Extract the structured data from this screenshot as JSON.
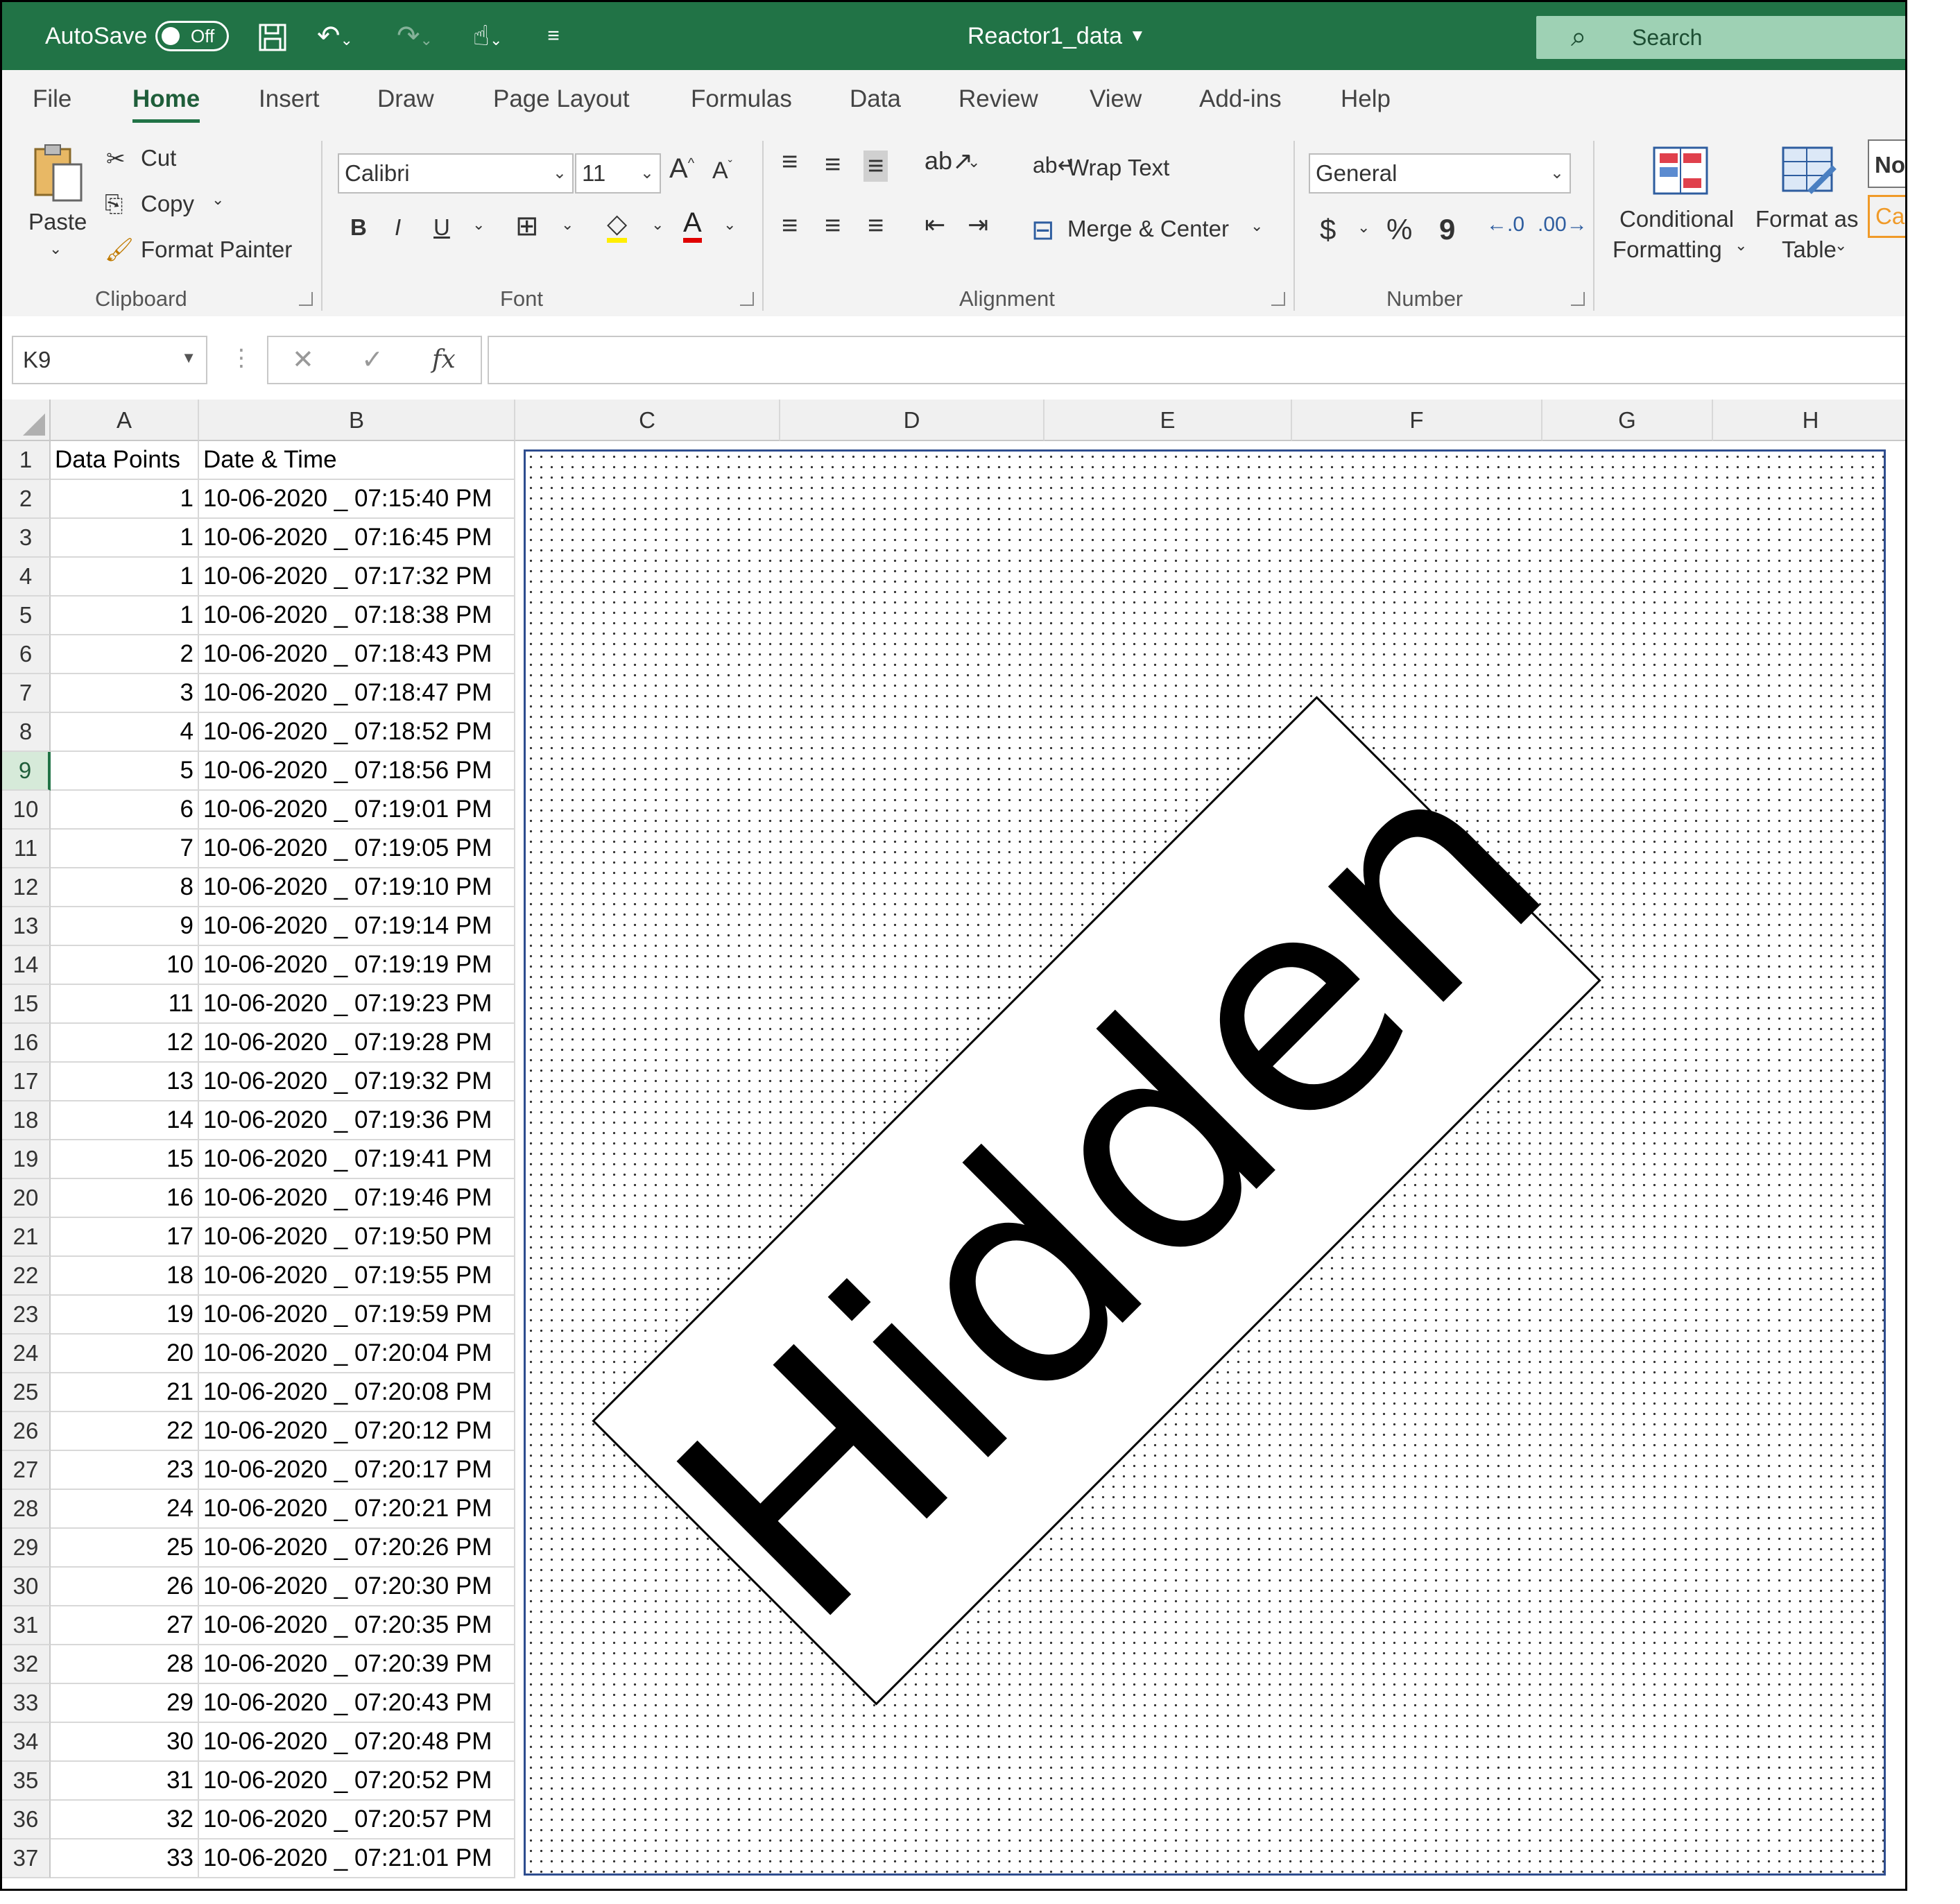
{
  "titlebar": {
    "autosave_label": "AutoSave",
    "autosave_state": "Off",
    "file_name": "Reactor1_data",
    "search_placeholder": "Search"
  },
  "tabs": [
    "File",
    "Home",
    "Insert",
    "Draw",
    "Page Layout",
    "Formulas",
    "Data",
    "Review",
    "View",
    "Add-ins",
    "Help"
  ],
  "ribbon": {
    "clipboard": {
      "paste": "Paste",
      "cut": "Cut",
      "copy": "Copy",
      "format_painter": "Format Painter",
      "group": "Clipboard"
    },
    "font": {
      "name": "Calibri",
      "size": "11",
      "bold": "B",
      "italic": "I",
      "underline": "U",
      "group": "Font"
    },
    "alignment": {
      "wrap": "Wrap Text",
      "merge": "Merge & Center",
      "group": "Alignment"
    },
    "number": {
      "format": "General",
      "currency": "$",
      "percent": "%",
      "comma": "9",
      "group": "Number"
    },
    "styles": {
      "conditional_1": "Conditional",
      "conditional_2": "Formatting",
      "table_1": "Format as",
      "table_2": "Table",
      "style_normal": "No",
      "style_calc": "Ca"
    }
  },
  "formula_bar": {
    "name_box": "K9",
    "fx": "fx",
    "value": ""
  },
  "columns": [
    "A",
    "B",
    "C",
    "D",
    "E",
    "F",
    "G",
    "H"
  ],
  "sheet": {
    "header": {
      "a": "Data Points",
      "b": "Date & Time"
    },
    "rows": [
      {
        "a": "1",
        "b": "10-06-2020 _ 07:15:40 PM"
      },
      {
        "a": "1",
        "b": "10-06-2020 _ 07:16:45 PM"
      },
      {
        "a": "1",
        "b": "10-06-2020 _ 07:17:32 PM"
      },
      {
        "a": "1",
        "b": "10-06-2020 _ 07:18:38 PM"
      },
      {
        "a": "2",
        "b": "10-06-2020 _ 07:18:43 PM"
      },
      {
        "a": "3",
        "b": "10-06-2020 _ 07:18:47 PM"
      },
      {
        "a": "4",
        "b": "10-06-2020 _ 07:18:52 PM"
      },
      {
        "a": "5",
        "b": "10-06-2020 _ 07:18:56 PM"
      },
      {
        "a": "6",
        "b": "10-06-2020 _ 07:19:01 PM"
      },
      {
        "a": "7",
        "b": "10-06-2020 _ 07:19:05 PM"
      },
      {
        "a": "8",
        "b": "10-06-2020 _ 07:19:10 PM"
      },
      {
        "a": "9",
        "b": "10-06-2020 _ 07:19:14 PM"
      },
      {
        "a": "10",
        "b": "10-06-2020 _ 07:19:19 PM"
      },
      {
        "a": "11",
        "b": "10-06-2020 _ 07:19:23 PM"
      },
      {
        "a": "12",
        "b": "10-06-2020 _ 07:19:28 PM"
      },
      {
        "a": "13",
        "b": "10-06-2020 _ 07:19:32 PM"
      },
      {
        "a": "14",
        "b": "10-06-2020 _ 07:19:36 PM"
      },
      {
        "a": "15",
        "b": "10-06-2020 _ 07:19:41 PM"
      },
      {
        "a": "16",
        "b": "10-06-2020 _ 07:19:46 PM"
      },
      {
        "a": "17",
        "b": "10-06-2020 _ 07:19:50 PM"
      },
      {
        "a": "18",
        "b": "10-06-2020 _ 07:19:55 PM"
      },
      {
        "a": "19",
        "b": "10-06-2020 _ 07:19:59 PM"
      },
      {
        "a": "20",
        "b": "10-06-2020 _ 07:20:04 PM"
      },
      {
        "a": "21",
        "b": "10-06-2020 _ 07:20:08 PM"
      },
      {
        "a": "22",
        "b": "10-06-2020 _ 07:20:12 PM"
      },
      {
        "a": "23",
        "b": "10-06-2020 _ 07:20:17 PM"
      },
      {
        "a": "24",
        "b": "10-06-2020 _ 07:20:21 PM"
      },
      {
        "a": "25",
        "b": "10-06-2020 _ 07:20:26 PM"
      },
      {
        "a": "26",
        "b": "10-06-2020 _ 07:20:30 PM"
      },
      {
        "a": "27",
        "b": "10-06-2020 _ 07:20:35 PM"
      },
      {
        "a": "28",
        "b": "10-06-2020 _ 07:20:39 PM"
      },
      {
        "a": "29",
        "b": "10-06-2020 _ 07:20:43 PM"
      },
      {
        "a": "30",
        "b": "10-06-2020 _ 07:20:48 PM"
      },
      {
        "a": "31",
        "b": "10-06-2020 _ 07:20:52 PM"
      },
      {
        "a": "32",
        "b": "10-06-2020 _ 07:20:57 PM"
      },
      {
        "a": "33",
        "b": "10-06-2020 _ 07:21:01 PM"
      }
    ]
  },
  "selected_row": 9,
  "overlay": {
    "label": "Hidden"
  },
  "colors": {
    "title_bar": "#217346",
    "selection_border": "#2e4d8f"
  }
}
